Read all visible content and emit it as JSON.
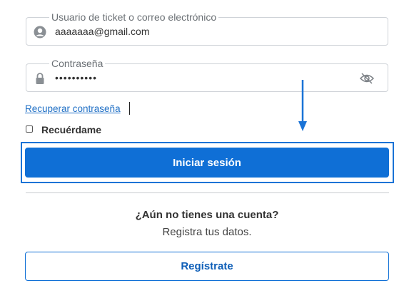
{
  "form": {
    "user_field": {
      "label": "Usuario de ticket o correo electrónico",
      "value": "aaaaaaa@gmail.com",
      "icon": "user-icon"
    },
    "password_field": {
      "label": "Contraseña",
      "value": "••••••••••",
      "icon": "lock-icon",
      "toggle_icon": "eye-icon"
    },
    "recover_link": "Recuperar contraseña",
    "remember_label": "Recuérdame",
    "login_button": "Iniciar sesión"
  },
  "signup": {
    "heading": "¿Aún no tienes una cuenta?",
    "prompt": "Registra tus datos.",
    "button": "Regístrate"
  },
  "colors": {
    "primary": "#0f6fd6",
    "link": "#1f6fc5",
    "annotation": "#1a73d6"
  }
}
